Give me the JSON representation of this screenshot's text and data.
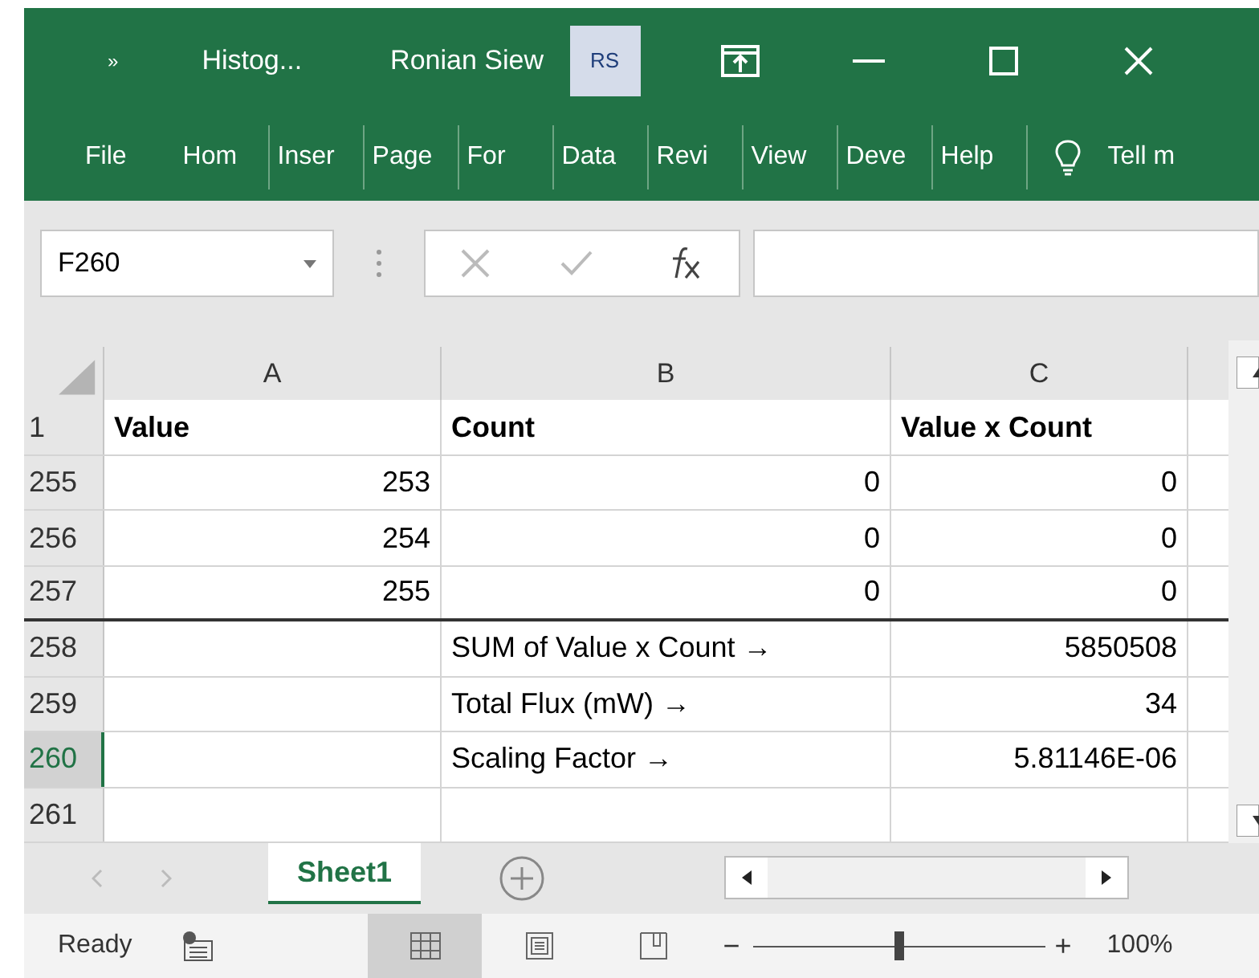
{
  "title_bar": {
    "quick_access": "»",
    "file_name": "Histog...",
    "user_name": "Ronian Siew",
    "user_initials": "RS"
  },
  "ribbon_tabs": [
    {
      "label": "File"
    },
    {
      "label": "Hom"
    },
    {
      "label": "Inser"
    },
    {
      "label": "Page"
    },
    {
      "label": "For"
    },
    {
      "label": "Data"
    },
    {
      "label": "Revi"
    },
    {
      "label": "View"
    },
    {
      "label": "Deve"
    },
    {
      "label": "Help"
    }
  ],
  "tell_me": "Tell m",
  "formula_bar": {
    "name_box": "F260"
  },
  "columns": [
    {
      "label": "A"
    },
    {
      "label": "B"
    },
    {
      "label": "C"
    }
  ],
  "rows": [
    {
      "header": "1",
      "selected": false,
      "kind": "heading",
      "rule_below": false,
      "cells": [
        "Value",
        "Count",
        "Value x Count"
      ]
    },
    {
      "header": "255",
      "selected": false,
      "kind": "data",
      "rule_below": false,
      "cells": [
        "253",
        "0",
        "0"
      ]
    },
    {
      "header": "256",
      "selected": false,
      "kind": "data",
      "rule_below": false,
      "cells": [
        "254",
        "0",
        "0"
      ]
    },
    {
      "header": "257",
      "selected": false,
      "kind": "data",
      "rule_below": true,
      "cells": [
        "255",
        "0",
        "0"
      ]
    },
    {
      "header": "258",
      "selected": false,
      "kind": "summary",
      "rule_below": false,
      "cells": [
        "",
        "SUM of Value x Count →",
        "5850508"
      ]
    },
    {
      "header": "259",
      "selected": false,
      "kind": "summary",
      "rule_below": false,
      "cells": [
        "",
        "Total Flux (mW) →",
        "34"
      ]
    },
    {
      "header": "260",
      "selected": true,
      "kind": "summary",
      "rule_below": false,
      "cells": [
        "",
        "Scaling Factor →",
        "5.81146E-06"
      ]
    },
    {
      "header": "261",
      "selected": false,
      "kind": "summary",
      "rule_below": false,
      "cells": [
        "",
        "",
        ""
      ]
    }
  ],
  "sheet_tabs": [
    {
      "label": "Sheet1",
      "selected": true
    }
  ],
  "status_bar": {
    "status": "Ready",
    "views": [
      {
        "kind": "normal",
        "selected": true
      },
      {
        "kind": "layout",
        "selected": false
      },
      {
        "kind": "pagebreak",
        "selected": false
      }
    ],
    "zoom": {
      "level": 0.5,
      "minus": "−",
      "plus": "+",
      "reading": "100%"
    }
  }
}
